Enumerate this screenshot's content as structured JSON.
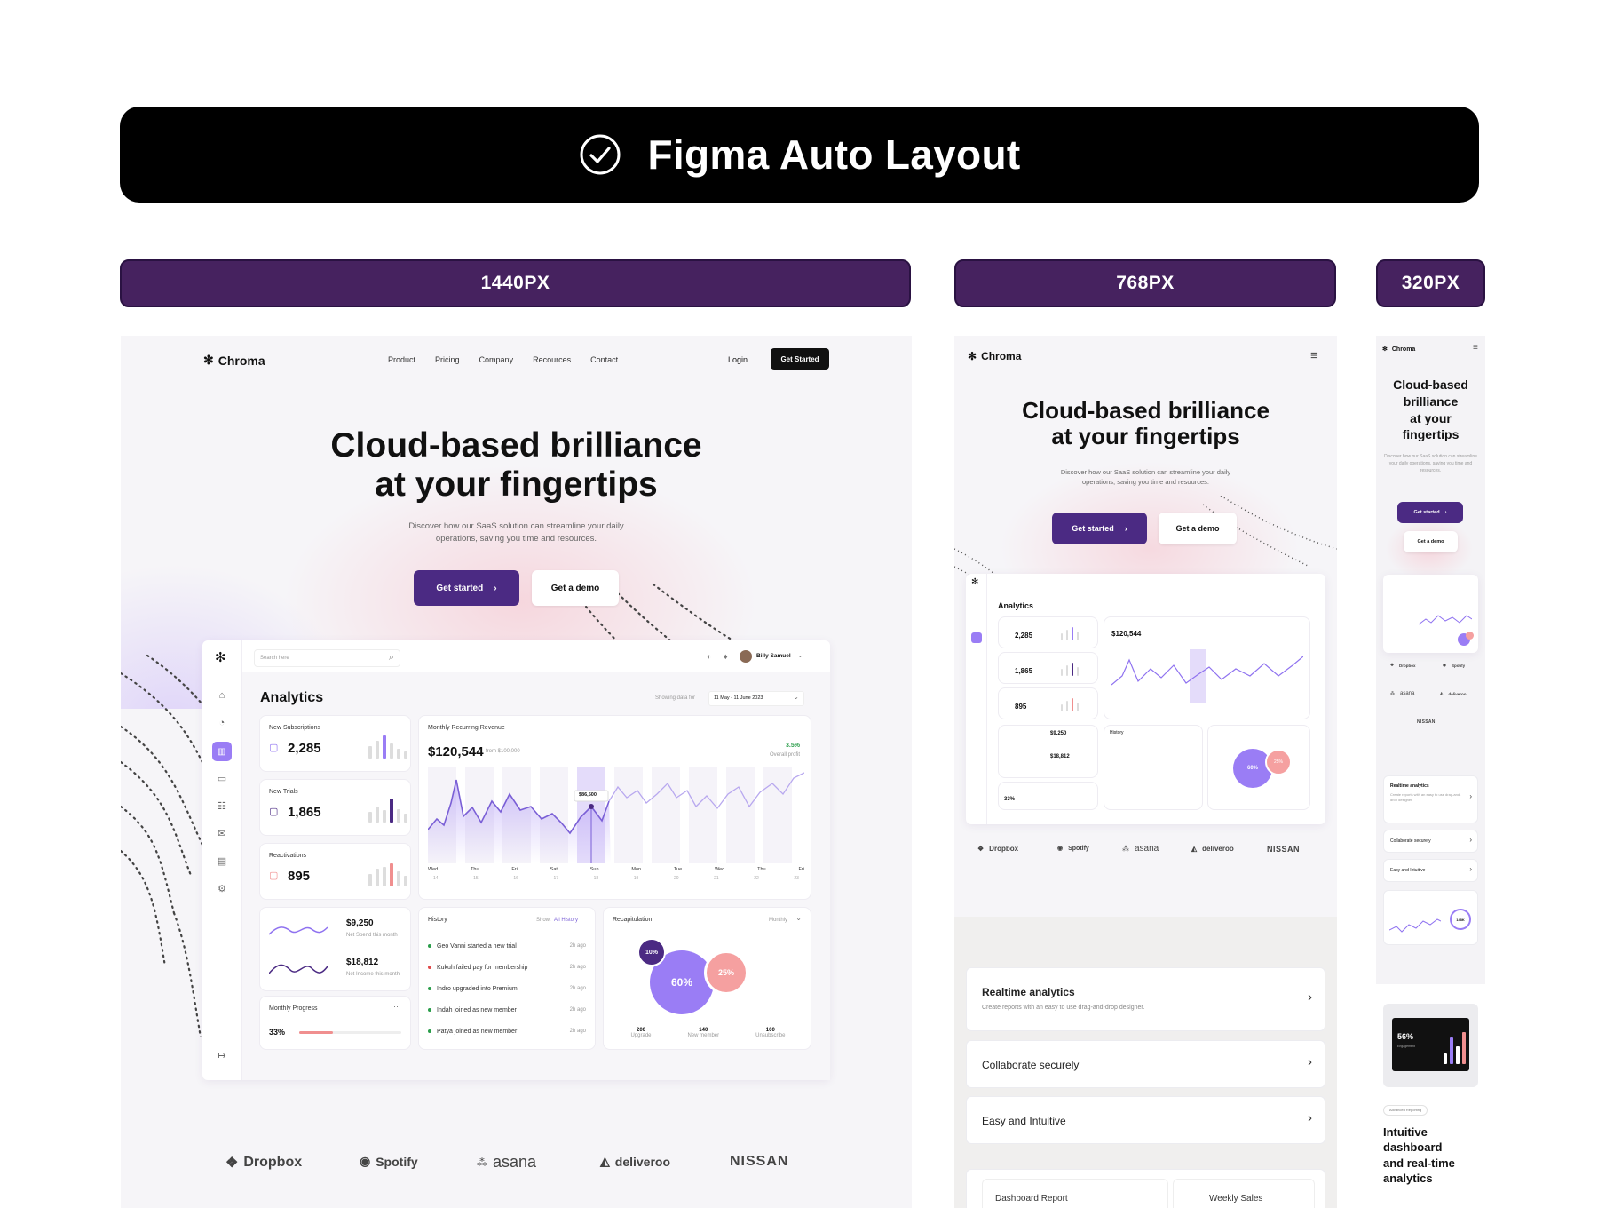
{
  "banner": {
    "title": "Figma Auto Layout"
  },
  "tags": {
    "t1440": "1440PX",
    "t768": "768PX",
    "t320": "320PX"
  },
  "brand": {
    "name": "Chroma"
  },
  "nav": {
    "items": [
      "Product",
      "Pricing",
      "Company",
      "Recources",
      "Contact"
    ],
    "login": "Login",
    "get_started": "Get Started"
  },
  "hero": {
    "title_l1": "Cloud-based brilliance",
    "title_l2": "at your fingertips",
    "subtitle_l1": "Discover how our SaaS solution can streamline your daily",
    "subtitle_l2": "operations, saving you time and resources.",
    "cta_primary": "Get started",
    "cta_secondary": "Get a demo"
  },
  "mobile_hero": {
    "l1": "Cloud-based",
    "l2": "brilliance",
    "l3": "at your",
    "l4": "fingertips"
  },
  "dashboard": {
    "search_placeholder": "Search here",
    "user": "Billy Samuel",
    "title": "Analytics",
    "showing": "Showing data for",
    "range": "11 May - 11 June 2023",
    "stats": [
      {
        "label": "New Subscriptions",
        "value": "2,285"
      },
      {
        "label": "New Trials",
        "value": "1,865"
      },
      {
        "label": "Reactivations",
        "value": "895"
      }
    ],
    "mrr": {
      "label": "Monthly Recurring Revenue",
      "value": "$120,544",
      "from": "from $100,000",
      "growth": "3.5%",
      "growth_label": "Overall profit",
      "tooltip": "$86,500",
      "days": [
        "Wed",
        "Thu",
        "Fri",
        "Sat",
        "Sun",
        "Mon",
        "Tue",
        "Wed",
        "Thu",
        "Fri"
      ],
      "dates": [
        "14",
        "15",
        "16",
        "17",
        "18",
        "19",
        "20",
        "21",
        "22",
        "23"
      ]
    },
    "spend": {
      "value": "$9,250",
      "label": "Net Spend this month"
    },
    "income": {
      "value": "$18,812",
      "label": "Net Income this month"
    },
    "progress": {
      "label": "Monthly Progress",
      "value": "33%",
      "fraction": 0.33
    },
    "history": {
      "title": "History",
      "show": "Show:",
      "filter": "All History",
      "rows": [
        {
          "text": "Geo Vanni started a new trial",
          "time": "2h ago"
        },
        {
          "text": "Kukuh failed pay for membership",
          "time": "2h ago"
        },
        {
          "text": "Indro upgraded into Premium",
          "time": "2h ago"
        },
        {
          "text": "Indah joined as new member",
          "time": "2h ago"
        },
        {
          "text": "Patya joined as new member",
          "time": "2h ago"
        }
      ]
    },
    "recap": {
      "title": "Recapitulation",
      "period": "Monthly",
      "p1": "10%",
      "p2": "60%",
      "p3": "25%",
      "stats": [
        {
          "v": "200",
          "l": "Upgrade"
        },
        {
          "v": "140",
          "l": "New member"
        },
        {
          "v": "100",
          "l": "Unsubscribe"
        }
      ]
    }
  },
  "brands": [
    "Dropbox",
    "Spotify",
    "asana",
    "deliveroo",
    "NISSAN"
  ],
  "features": [
    {
      "title": "Realtime analytics",
      "desc": "Create reports with an easy to use drag-and-drop designer."
    },
    {
      "title": "Collaborate securely"
    },
    {
      "title": "Easy and Intuitive"
    }
  ],
  "tabs": {
    "report": "Dashboard Report",
    "sales": "Weekly Sales"
  },
  "mobile_feature": {
    "badge": "Advanced Reporting",
    "l1": "Intuitive",
    "l2": "dashboard",
    "l3": "and real-time",
    "l4": "analytics",
    "stat": "56%",
    "stat_label": "Engagement",
    "ring": "148K"
  },
  "colors": {
    "primary": "#4b2a83",
    "banner": "#000000",
    "tag": "#46225f",
    "accent_pink": "#f08f8f",
    "accent_purple": "#8f72f0"
  }
}
